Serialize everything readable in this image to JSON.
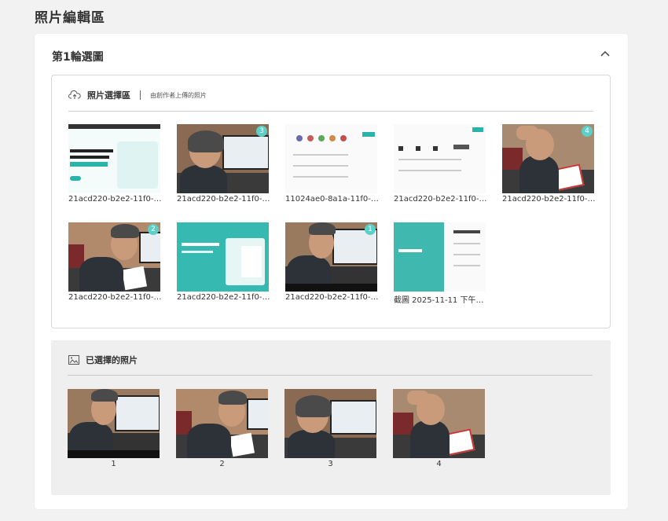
{
  "page_title": "照片編輯區",
  "round": {
    "title": "第1輪選圖"
  },
  "select_section": {
    "label": "照片選擇區",
    "sub": "由創作者上傳的照片",
    "photos": [
      {
        "caption": "21acd220-b2e2-11f0-…",
        "badge": ""
      },
      {
        "caption": "21acd220-b2e2-11f0-…",
        "badge": "3"
      },
      {
        "caption": "11024ae0-8a1a-11f0-…",
        "badge": ""
      },
      {
        "caption": "21acd220-b2e2-11f0-…",
        "badge": ""
      },
      {
        "caption": "21acd220-b2e2-11f0-…",
        "badge": "4"
      },
      {
        "caption": "21acd220-b2e2-11f0-…",
        "badge": "2"
      },
      {
        "caption": "21acd220-b2e2-11f0-…",
        "badge": ""
      },
      {
        "caption": "21acd220-b2e2-11f0-…",
        "badge": "1"
      },
      {
        "caption": "截圖 2025-11-11 下午…",
        "badge": ""
      }
    ]
  },
  "selected_section": {
    "label": "已選擇的照片",
    "photos": [
      {
        "num": "1"
      },
      {
        "num": "2"
      },
      {
        "num": "3"
      },
      {
        "num": "4"
      }
    ]
  },
  "colors": {
    "accent": "#5ccfc6",
    "page_bg": "#f2f2f2",
    "selected_bg": "#efefef"
  },
  "icons": {
    "collapse": "chevron-up-icon",
    "upload": "cloud-upload-icon",
    "image": "image-icon"
  }
}
